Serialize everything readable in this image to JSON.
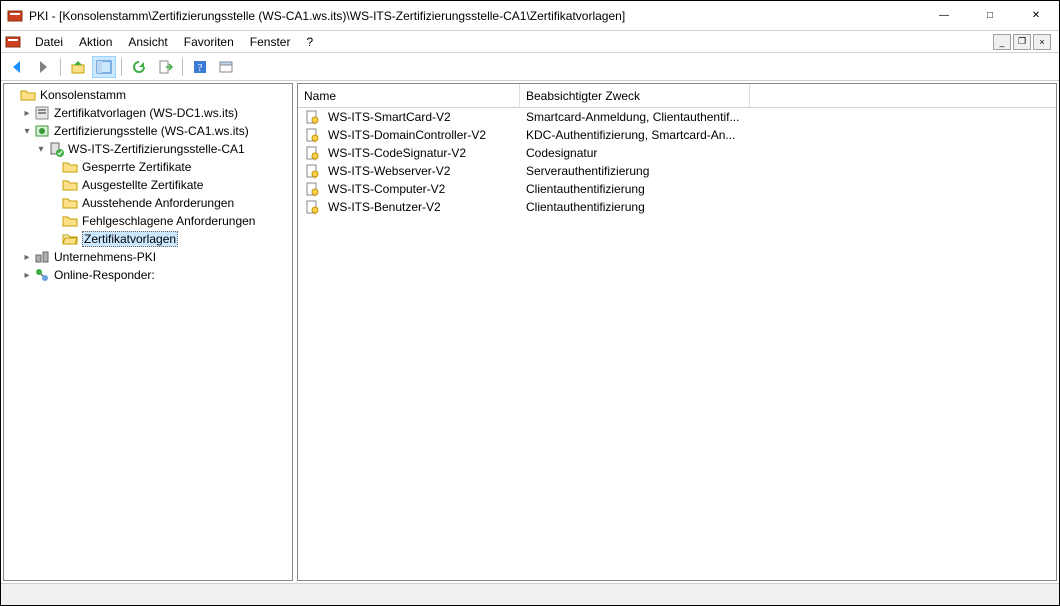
{
  "window": {
    "title": "PKI - [Konsolenstamm\\Zertifizierungsstelle (WS-CA1.ws.its)\\WS-ITS-Zertifizierungsstelle-CA1\\Zertifikatvorlagen]"
  },
  "menu": {
    "items": [
      "Datei",
      "Aktion",
      "Ansicht",
      "Favoriten",
      "Fenster",
      "?"
    ]
  },
  "tree": {
    "root": "Konsolenstamm",
    "cert_templates_ws_dc1": "Zertifikatvorlagen (WS-DC1.ws.its)",
    "ca_ws_ca1": "Zertifizierungsstelle (WS-CA1.ws.its)",
    "ws_its_ca1": "WS-ITS-Zertifizierungsstelle-CA1",
    "revoked": "Gesperrte Zertifikate",
    "issued": "Ausgestellte Zertifikate",
    "pending": "Ausstehende Anforderungen",
    "failed": "Fehlgeschlagene Anforderungen",
    "cert_templates": "Zertifikatvorlagen",
    "enterprise_pki": "Unternehmens-PKI",
    "online_responder": "Online-Responder:"
  },
  "list": {
    "headers": {
      "name": "Name",
      "purpose": "Beabsichtigter Zweck"
    },
    "rows": [
      {
        "name": "WS-ITS-SmartCard-V2",
        "purpose": "Smartcard-Anmeldung, Clientauthentif..."
      },
      {
        "name": "WS-ITS-DomainController-V2",
        "purpose": "KDC-Authentifizierung, Smartcard-An..."
      },
      {
        "name": "WS-ITS-CodeSignatur-V2",
        "purpose": "Codesignatur"
      },
      {
        "name": "WS-ITS-Webserver-V2",
        "purpose": "Serverauthentifizierung"
      },
      {
        "name": "WS-ITS-Computer-V2",
        "purpose": "Clientauthentifizierung"
      },
      {
        "name": "WS-ITS-Benutzer-V2",
        "purpose": "Clientauthentifizierung"
      }
    ]
  }
}
